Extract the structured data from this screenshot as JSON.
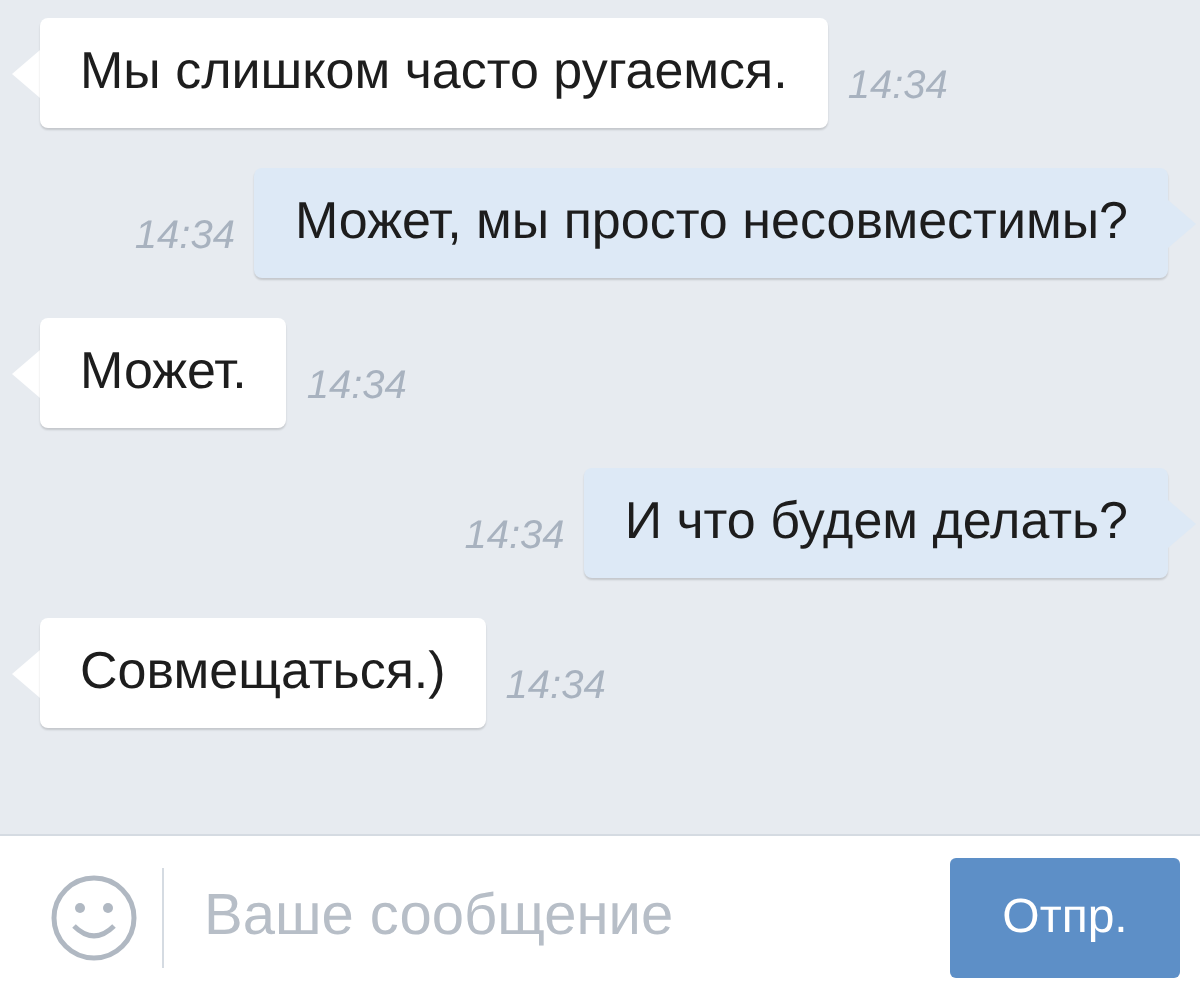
{
  "messages": [
    {
      "kind": "incoming",
      "text": "Мы слишком часто ругаемся.",
      "time": "14:34"
    },
    {
      "kind": "outgoing",
      "text": "Может, мы просто несовместимы?",
      "time": "14:34"
    },
    {
      "kind": "incoming",
      "text": "Может.",
      "time": "14:34"
    },
    {
      "kind": "outgoing",
      "text": "И что будем делать?",
      "time": "14:34"
    },
    {
      "kind": "incoming",
      "text": "Совмещаться.)",
      "time": "14:34"
    }
  ],
  "composer": {
    "placeholder": "Ваше сообщение",
    "send_button": "Отпр."
  }
}
